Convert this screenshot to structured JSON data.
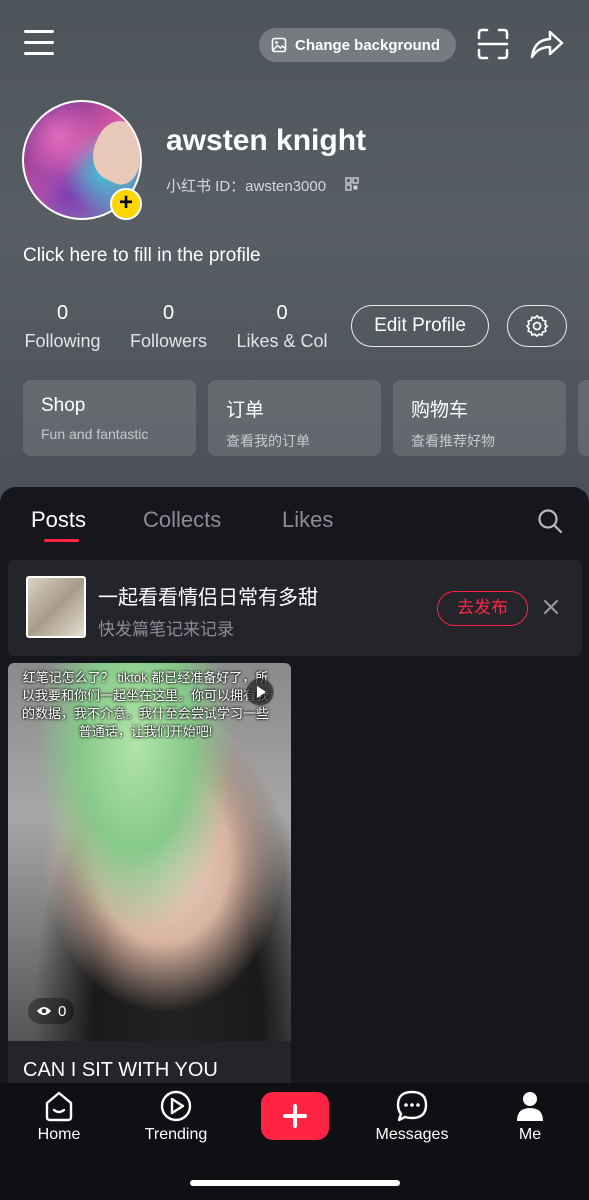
{
  "header": {
    "change_background": "Change background"
  },
  "profile": {
    "name": "awsten knight",
    "id_label": "小红书 ID：awsten3000",
    "bio_prompt": "Click here to fill in the profile",
    "stats": [
      {
        "value": "0",
        "label": "Following"
      },
      {
        "value": "0",
        "label": "Followers"
      },
      {
        "value": "0",
        "label": "Likes & Col"
      }
    ],
    "edit_profile": "Edit Profile"
  },
  "cards": [
    {
      "title": "Shop",
      "subtitle": "Fun and fantastic"
    },
    {
      "title": "订单",
      "subtitle": "查看我的订单"
    },
    {
      "title": "购物车",
      "subtitle": "查看推荐好物"
    }
  ],
  "tabs": [
    "Posts",
    "Collects",
    "Likes"
  ],
  "promo": {
    "title": "一起看看情侣日常有多甜",
    "subtitle": "快发篇笔记来记录",
    "publish": "去发布"
  },
  "post": {
    "overlay_text": "红笔记怎么了？ tiktok 都已经准备好了，所以我要和你们一起坐在这里。你可以拥有我的数据，我不介意。我什至会尝试学习一些普通话，让我们开始吧!",
    "views": "0",
    "title": "CAN I SIT WITH YOU"
  },
  "bottom_nav": [
    {
      "label": "Home",
      "icon": "home-icon"
    },
    {
      "label": "Trending",
      "icon": "play-circle-icon"
    },
    {
      "label": "",
      "icon": "plus-icon"
    },
    {
      "label": "Messages",
      "icon": "chat-icon"
    },
    {
      "label": "Me",
      "icon": "person-icon"
    }
  ],
  "colors": {
    "accent": "#ff2442",
    "avatar_badge": "#ffd500"
  }
}
